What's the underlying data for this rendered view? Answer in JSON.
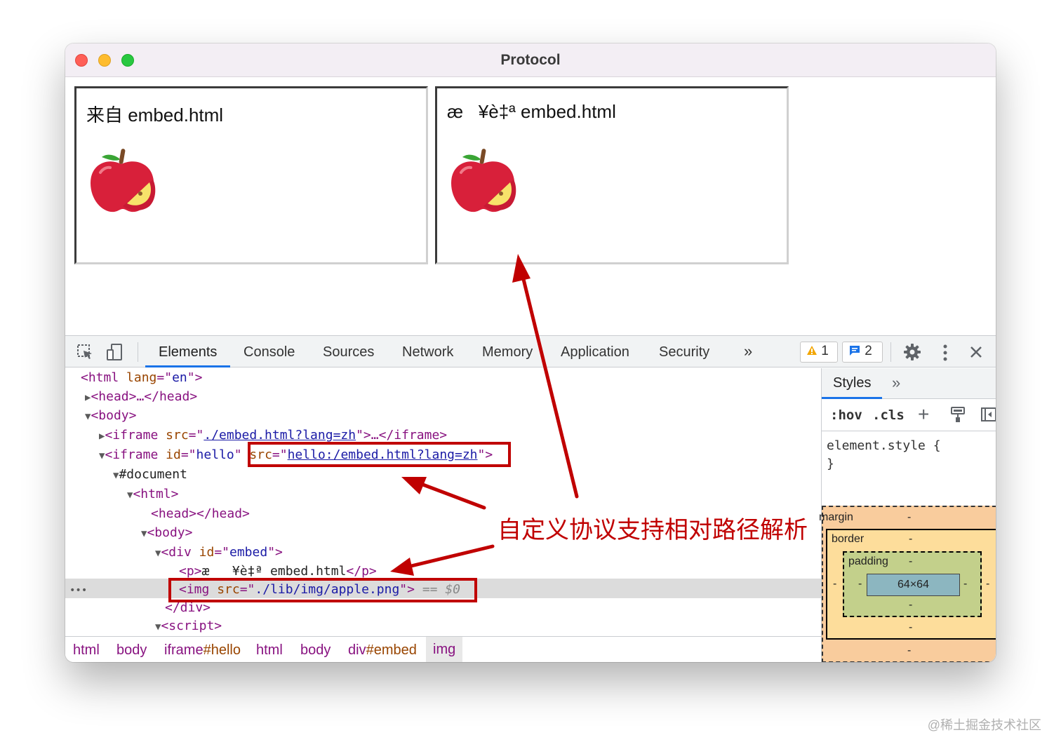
{
  "window": {
    "title": "Protocol"
  },
  "iframes": [
    {
      "text": "来自 embed.html"
    },
    {
      "text": "æ   ¥è‡ª embed.html"
    }
  ],
  "devtools": {
    "tabs": [
      "Elements",
      "Console",
      "Sources",
      "Network",
      "Memory",
      "Application",
      "Security"
    ],
    "more": "»",
    "warnings": "1",
    "messages": "2",
    "dom": {
      "l1": {
        "open": "<html ",
        "attr": "lang",
        "eq": "=\"",
        "val": "en",
        "close": "\">"
      },
      "l2": {
        "text": "<head>…</head>"
      },
      "l3": {
        "text": "<body>"
      },
      "l4": {
        "open": "<iframe ",
        "attr": "src",
        "eq": "=\"",
        "link": "./embed.html?lang=zh",
        "close": "\">…</iframe>"
      },
      "l5": {
        "open": "<iframe ",
        "attr": "id",
        "eq": "=\"",
        "val": "hello",
        "q": "\" ",
        "attr2": "src",
        "eq2": "=\"",
        "link": "hello:/embed.html?lang=zh",
        "close": "\">"
      },
      "l6": {
        "text": "#document"
      },
      "l7": {
        "text": "<html>"
      },
      "l8": {
        "text": "<head></head>"
      },
      "l9": {
        "text": "<body>"
      },
      "l10": {
        "open": "<div ",
        "attr": "id",
        "eq": "=\"",
        "val": "embed",
        "close": "\">"
      },
      "l11": {
        "open": "<p>",
        "text": "æ   ¥è‡ª embed.html",
        "close": "</p>"
      },
      "l12": {
        "open": "<img ",
        "attr": "src",
        "eq": "=\"",
        "val": "./lib/img/apple.png",
        "close": "\">",
        "eq_ref": " == $0"
      },
      "l13": {
        "text": "</div>"
      },
      "l14": {
        "text": "<script>"
      },
      "ellipsis": "•••"
    },
    "breadcrumbs": {
      "b1": "html",
      "b2": "body",
      "b3_tag": "iframe",
      "b3_id": "#hello",
      "b4": "html",
      "b5": "body",
      "b6_tag": "div",
      "b6_id": "#embed",
      "b7": "img"
    },
    "styles": {
      "tab": "Styles",
      "more": "»",
      "hov": ":hov",
      "cls": ".cls",
      "plus": "+",
      "rule": "element.style {\n}",
      "box": {
        "margin": "margin",
        "border": "border",
        "padding": "padding",
        "content": "64×64",
        "dash": "-"
      }
    }
  },
  "annotation": "自定义协议支持相对路径解析",
  "watermark": "@稀土掘金技术社区"
}
